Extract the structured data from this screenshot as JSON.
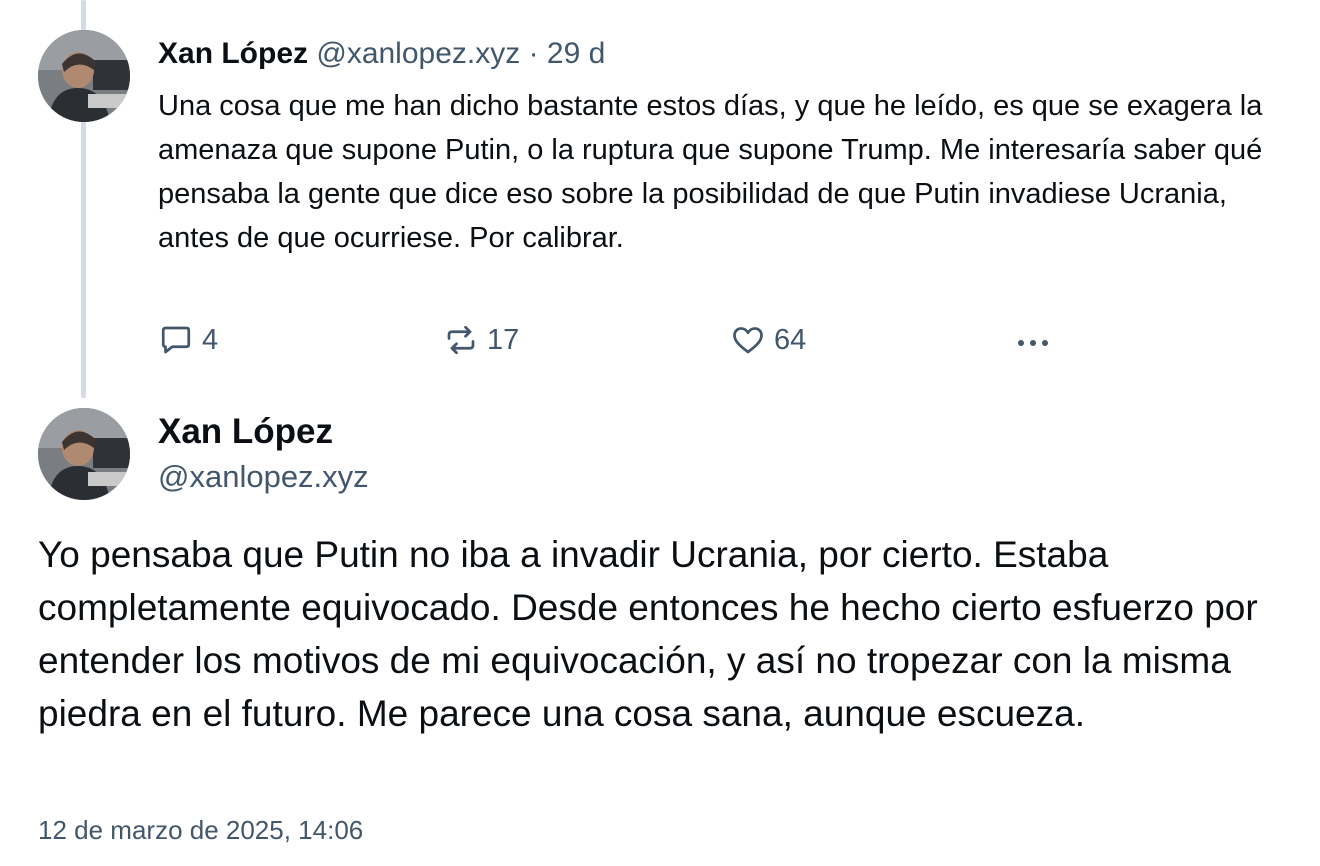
{
  "reply_post": {
    "author_name": "Xan López",
    "handle": "@xanlopez.xyz",
    "separator": " · ",
    "age": "29 d",
    "text": "Una cosa que me han dicho bastante estos días, y que he leído, es que se exagera la amenaza que supone Putin, o la ruptura que supone Trump. Me interesaría saber qué pensaba la gente que dice eso sobre la posibilidad de que Putin invadiese Ucrania, antes de que ocurriese. Por calibrar.",
    "actions": {
      "reply_count": "4",
      "repost_count": "17",
      "like_count": "64",
      "reply_icon": "speech-bubble-icon",
      "repost_icon": "repost-arrows-icon",
      "like_icon": "heart-icon",
      "more_icon": "ellipsis-icon"
    }
  },
  "main_post": {
    "author_name": "Xan López",
    "handle": "@xanlopez.xyz",
    "text": "Yo pensaba que Putin no iba a invadir Ucrania, por cierto. Estaba completamente equivocado. Desde entonces he hecho cierto esfuerzo por entender los motivos de mi equivocación, y así no tropezar con la misma piedra en el futuro. Me parece una cosa sana, aunque escueza.",
    "timestamp": "12 de marzo de 2025, 14:06"
  },
  "colors": {
    "text_primary": "#0b0f14",
    "text_secondary": "#42576c",
    "thread_line": "#d4dbe2",
    "background": "#ffffff"
  }
}
